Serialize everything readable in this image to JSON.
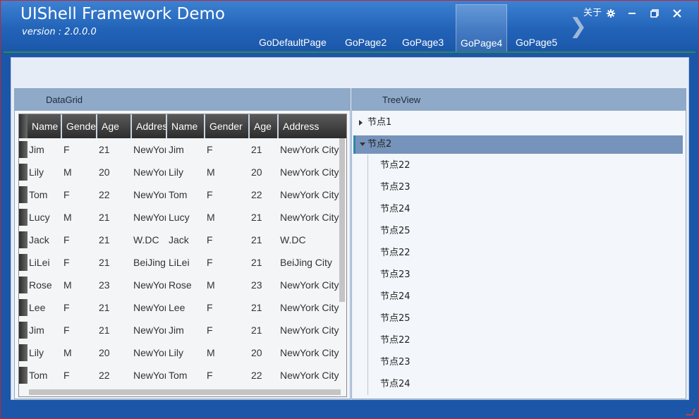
{
  "app": {
    "title": "UIShell Framework Demo",
    "version": "version : 2.0.0.0"
  },
  "nav": {
    "tabs": [
      "GoDefaultPage",
      "GoPage2",
      "GoPage3",
      "GoPage4",
      "GoPage5"
    ],
    "active": "GoPage4",
    "next_icon": "chevron-right-icon"
  },
  "window_controls": {
    "about_label": "关于",
    "settings_icon": "gear-icon",
    "minimize_icon": "minimize-icon",
    "maximize_icon": "maximize-icon",
    "close_icon": "close-icon"
  },
  "datagrid": {
    "title": "DataGrid",
    "columns": [
      "Name",
      "Gender",
      "Age",
      "Address",
      "Name",
      "Gender",
      "Age",
      "Address"
    ],
    "rows": [
      [
        "Jim",
        "F",
        "21",
        "NewYork City",
        "Jim",
        "F",
        "21",
        "NewYork City"
      ],
      [
        "Lily",
        "M",
        "20",
        "NewYork City",
        "Lily",
        "M",
        "20",
        "NewYork City"
      ],
      [
        "Tom",
        "F",
        "22",
        "NewYork City",
        "Tom",
        "F",
        "22",
        "NewYork City"
      ],
      [
        "Lucy",
        "M",
        "21",
        "NewYork City",
        "Lucy",
        "M",
        "21",
        "NewYork City"
      ],
      [
        "Jack",
        "F",
        "21",
        "W.DC",
        "Jack",
        "F",
        "21",
        "W.DC"
      ],
      [
        "LiLei",
        "F",
        "21",
        "BeiJing City",
        "LiLei",
        "F",
        "21",
        "BeiJing City"
      ],
      [
        "Rose",
        "M",
        "23",
        "NewYork City",
        "Rose",
        "M",
        "23",
        "NewYork City"
      ],
      [
        "Lee",
        "F",
        "21",
        "NewYork City",
        "Lee",
        "F",
        "21",
        "NewYork City"
      ],
      [
        "Jim",
        "F",
        "21",
        "NewYork City",
        "Jim",
        "F",
        "21",
        "NewYork City"
      ],
      [
        "Lily",
        "M",
        "20",
        "NewYork City",
        "Lily",
        "M",
        "20",
        "NewYork City"
      ],
      [
        "Tom",
        "F",
        "22",
        "NewYork City",
        "Tom",
        "F",
        "22",
        "NewYork City"
      ]
    ]
  },
  "treeview": {
    "title": "TreeView",
    "nodes": [
      {
        "label": "节点1",
        "expanded": false
      },
      {
        "label": "节点2",
        "expanded": true,
        "selected": true,
        "children": [
          "节点22",
          "节点23",
          "节点24",
          "节点25",
          "节点22",
          "节点23",
          "节点24",
          "节点25",
          "节点22",
          "节点23",
          "节点24"
        ]
      }
    ]
  },
  "colors": {
    "title_bar": "#2263b8",
    "accent_line": "#2b8a55",
    "panel_header": "#8fa9c8",
    "selected_node": "#7693bb",
    "window_border": "#c9242b"
  }
}
